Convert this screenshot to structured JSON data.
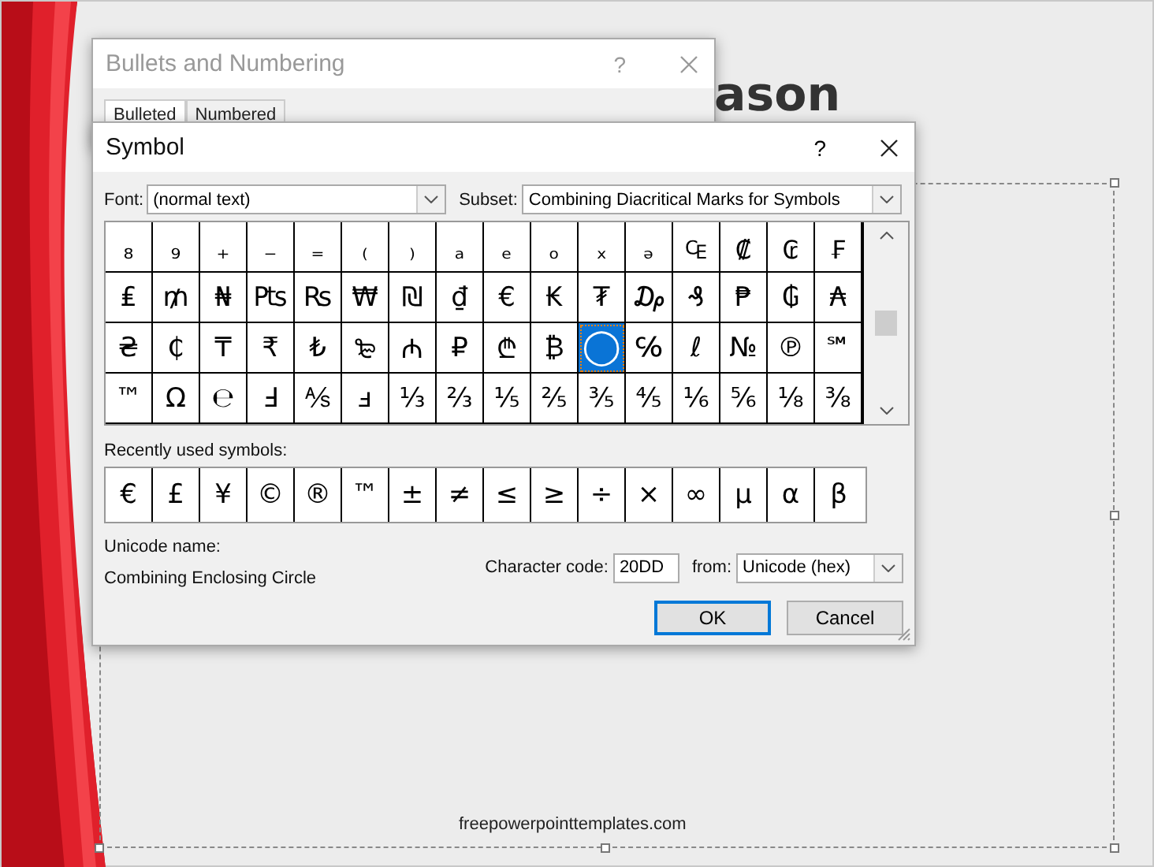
{
  "slide": {
    "title_fragment": "ason",
    "footer": "freepowerpointtemplates.com"
  },
  "bullets_dialog": {
    "title": "Bullets and Numbering",
    "help": "?",
    "tabs": [
      {
        "label": "Bulleted",
        "selected": true
      },
      {
        "label": "Numbered",
        "selected": false
      }
    ]
  },
  "symbol_dialog": {
    "title": "Symbol",
    "help": "?",
    "font_label": "Font:",
    "font_value": "(normal text)",
    "subset_label": "Subset:",
    "subset_value": "Combining Diacritical Marks for Symbols",
    "symbol_rows": [
      [
        {
          "char": "₈",
          "selected": false
        },
        {
          "char": "₉",
          "selected": false
        },
        {
          "char": "₊",
          "selected": false
        },
        {
          "char": "₋",
          "selected": false
        },
        {
          "char": "₌",
          "selected": false
        },
        {
          "char": "₍",
          "selected": false
        },
        {
          "char": "₎",
          "selected": false
        },
        {
          "char": "ₐ",
          "selected": false
        },
        {
          "char": "ₑ",
          "selected": false
        },
        {
          "char": "ₒ",
          "selected": false
        },
        {
          "char": "ₓ",
          "selected": false
        },
        {
          "char": "ₔ",
          "selected": false
        },
        {
          "char": "₠",
          "selected": false
        },
        {
          "char": "₡",
          "selected": false
        },
        {
          "char": "₢",
          "selected": false
        },
        {
          "char": "₣",
          "selected": false
        }
      ],
      [
        {
          "char": "₤",
          "selected": false
        },
        {
          "char": "₥",
          "selected": false
        },
        {
          "char": "₦",
          "selected": false
        },
        {
          "char": "₧",
          "selected": false
        },
        {
          "char": "₨",
          "selected": false
        },
        {
          "char": "₩",
          "selected": false
        },
        {
          "char": "₪",
          "selected": false
        },
        {
          "char": "₫",
          "selected": false
        },
        {
          "char": "€",
          "selected": false
        },
        {
          "char": "₭",
          "selected": false
        },
        {
          "char": "₮",
          "selected": false
        },
        {
          "char": "₯",
          "selected": false
        },
        {
          "char": "₰",
          "selected": false
        },
        {
          "char": "₱",
          "selected": false
        },
        {
          "char": "₲",
          "selected": false
        },
        {
          "char": "₳",
          "selected": false
        }
      ],
      [
        {
          "char": "₴",
          "selected": false
        },
        {
          "char": "₵",
          "selected": false
        },
        {
          "char": "₸",
          "selected": false
        },
        {
          "char": "₹",
          "selected": false
        },
        {
          "char": "₺",
          "selected": false
        },
        {
          "char": "₻",
          "selected": false
        },
        {
          "char": "₼",
          "selected": false
        },
        {
          "char": "₽",
          "selected": false
        },
        {
          "char": "₾",
          "selected": false
        },
        {
          "char": "₿",
          "selected": false
        },
        {
          "char": "◯",
          "selected": true
        },
        {
          "char": "℅",
          "selected": false
        },
        {
          "char": "ℓ",
          "selected": false
        },
        {
          "char": "№",
          "selected": false
        },
        {
          "char": "℗",
          "selected": false
        },
        {
          "char": "℠",
          "selected": false
        }
      ],
      [
        {
          "char": "™",
          "selected": false
        },
        {
          "char": "Ω",
          "selected": false
        },
        {
          "char": "℮",
          "selected": false
        },
        {
          "char": "Ⅎ",
          "selected": false
        },
        {
          "char": "⅍",
          "selected": false
        },
        {
          "char": "ⅎ",
          "selected": false
        },
        {
          "char": "⅓",
          "selected": false
        },
        {
          "char": "⅔",
          "selected": false
        },
        {
          "char": "⅕",
          "selected": false
        },
        {
          "char": "⅖",
          "selected": false
        },
        {
          "char": "⅗",
          "selected": false
        },
        {
          "char": "⅘",
          "selected": false
        },
        {
          "char": "⅙",
          "selected": false
        },
        {
          "char": "⅚",
          "selected": false
        },
        {
          "char": "⅛",
          "selected": false
        },
        {
          "char": "⅜",
          "selected": false
        }
      ]
    ],
    "recent_label": "Recently used symbols:",
    "recent_symbols": [
      "€",
      "£",
      "¥",
      "©",
      "®",
      "™",
      "±",
      "≠",
      "≤",
      "≥",
      "÷",
      "×",
      "∞",
      "µ",
      "α",
      "β"
    ],
    "unicode_name_label": "Unicode name:",
    "unicode_name": "Combining Enclosing Circle",
    "character_code_label": "Character code:",
    "character_code": "20DD",
    "from_label": "from:",
    "from_value": "Unicode (hex)",
    "buttons": [
      "OK",
      "Cancel"
    ]
  }
}
